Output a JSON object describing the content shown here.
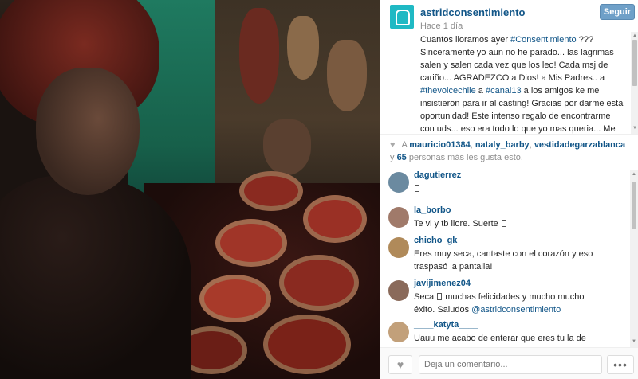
{
  "header": {
    "username": "astridconsentimiento",
    "follow_label": "Seguir",
    "time": "Hace 1 día"
  },
  "caption": {
    "parts": [
      {
        "t": "Cuantos lloramos ayer ",
        "tag": false
      },
      {
        "t": "#Consentimiento",
        "tag": true
      },
      {
        "t": " ??? Sinceramente yo aun no he parado... las lagrimas salen y salen cada vez que los leo! Cada msj de cariño... AGRADEZCO a Dios! a Mis Padres.. a ",
        "tag": false
      },
      {
        "t": "#thevoicechile",
        "tag": true
      },
      {
        "t": " a ",
        "tag": false
      },
      {
        "t": "#canal13",
        "tag": true
      },
      {
        "t": " a los amigos ke me insistieron para ir al casting! Gracias por darme esta oportunidad! Este intenso regalo de encontrarme con uds... eso era todo lo que yo mas queria... Me",
        "tag": false
      }
    ]
  },
  "likes": {
    "prefix": "A",
    "users": [
      "mauricio01384",
      "nataly_barby",
      "vestidadegarzablanca"
    ],
    "sep1": ",",
    "sep2": ",",
    "conj": "y",
    "count": "65",
    "suffix": "personas más les gusta esto."
  },
  "comments": [
    {
      "user": "dagutierrez",
      "text": "",
      "glyph": true,
      "text_after": "",
      "avatar_color": "#6b8aa0"
    },
    {
      "user": "la_borbo",
      "text": "Te vi y tb llore. Suerte",
      "glyph": true,
      "text_after": "",
      "avatar_color": "#a07a6a"
    },
    {
      "user": "chicho_gk",
      "text": "Eres muy seca, cantaste con el corazón y eso traspasó la pantalla!",
      "glyph": false,
      "text_after": "",
      "avatar_color": "#b08a5a"
    },
    {
      "user": "javijimenez04",
      "text": "Seca",
      "glyph": true,
      "text_after": " muchas felicidades y mucho mucho éxito. Saludos ",
      "mention": "@astridconsentimiento",
      "avatar_color": "#8a6a5a"
    },
    {
      "user": "____katyta____",
      "text": "Uauu me acabo de enterar que eres tu la de the",
      "glyph": false,
      "text_after": "",
      "avatar_color": "#c2a07a"
    }
  ],
  "footer": {
    "comment_placeholder": "Deja un comentario...",
    "more_label": "•••"
  },
  "colors": {
    "link": "#125688",
    "follow_button": "#6fa0c8",
    "avatar_brand": "#1fb9c4"
  },
  "icons": [
    "heart-icon",
    "more-icon",
    "profile-avatar"
  ]
}
